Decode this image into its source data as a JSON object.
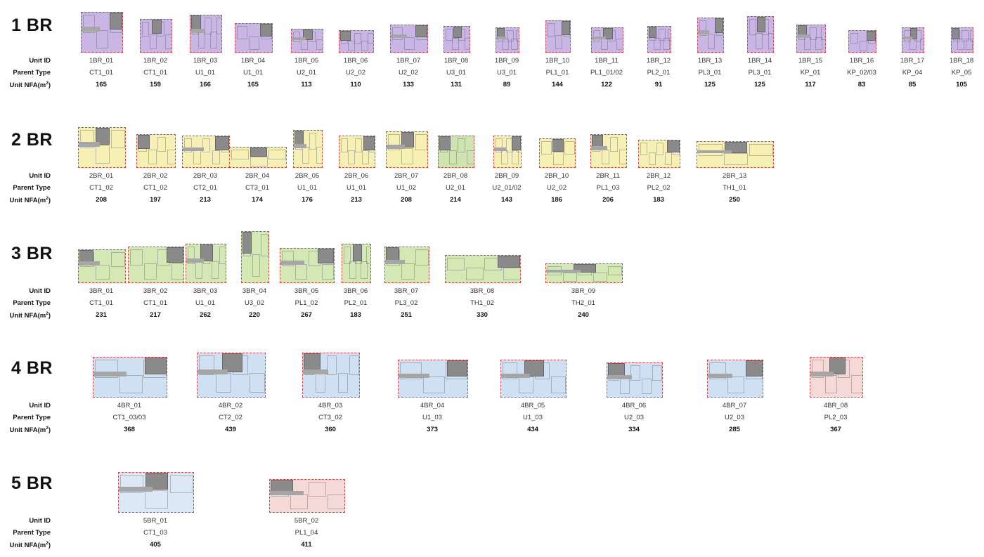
{
  "colors": {
    "1BR": "#c9b6e4",
    "2BR": "#f6f0b5",
    "2BR_alt": "#cfe3b0",
    "3BR": "#d3e8b4",
    "4BR": "#cfe0f3",
    "4BR_alt": "#f4d9d6",
    "5BR": "#dde8f5",
    "5BR_alt": "#f4d9d6",
    "core": "#8a8a8a",
    "boundary": "#dd4444"
  },
  "row_labels": {
    "unit_id": "Unit ID",
    "parent_type": "Parent Type",
    "nfa": "Unit NFA(m",
    "nfa_sup": "2",
    "nfa_close": ")"
  },
  "sections": [
    {
      "title": "1 BR",
      "units": [
        {
          "id": "1BR_01",
          "parent": "CT1_01",
          "nfa": "165"
        },
        {
          "id": "1BR_02",
          "parent": "CT1_01",
          "nfa": "159"
        },
        {
          "id": "1BR_03",
          "parent": "U1_01",
          "nfa": "166"
        },
        {
          "id": "1BR_04",
          "parent": "U1_01",
          "nfa": "165"
        },
        {
          "id": "1BR_05",
          "parent": "U2_01",
          "nfa": "113"
        },
        {
          "id": "1BR_06",
          "parent": "U2_02",
          "nfa": "110"
        },
        {
          "id": "1BR_07",
          "parent": "U2_02",
          "nfa": "133"
        },
        {
          "id": "1BR_08",
          "parent": "U3_01",
          "nfa": "131"
        },
        {
          "id": "1BR_09",
          "parent": "U3_01",
          "nfa": "89"
        },
        {
          "id": "1BR_10",
          "parent": "PL1_01",
          "nfa": "144"
        },
        {
          "id": "1BR_11",
          "parent": "PL1_01/02",
          "nfa": "122"
        },
        {
          "id": "1BR_12",
          "parent": "PL2_01",
          "nfa": "91"
        },
        {
          "id": "1BR_13",
          "parent": "PL3_01",
          "nfa": "125"
        },
        {
          "id": "1BR_14",
          "parent": "PL3_01",
          "nfa": "125"
        },
        {
          "id": "1BR_15",
          "parent": "KP_01",
          "nfa": "117"
        },
        {
          "id": "1BR_16",
          "parent": "KP_02/03",
          "nfa": "83"
        },
        {
          "id": "1BR_17",
          "parent": "KP_04",
          "nfa": "85"
        },
        {
          "id": "1BR_18",
          "parent": "KP_05",
          "nfa": "105"
        }
      ]
    },
    {
      "title": "2 BR",
      "units": [
        {
          "id": "2BR_01",
          "parent": "CT1_02",
          "nfa": "208"
        },
        {
          "id": "2BR_02",
          "parent": "CT1_02",
          "nfa": "197"
        },
        {
          "id": "2BR_03",
          "parent": "CT2_01",
          "nfa": "213"
        },
        {
          "id": "2BR_04",
          "parent": "CT3_01",
          "nfa": "174"
        },
        {
          "id": "2BR_05",
          "parent": "U1_01",
          "nfa": "176"
        },
        {
          "id": "2BR_06",
          "parent": "U1_01",
          "nfa": "213"
        },
        {
          "id": "2BR_07",
          "parent": "U1_02",
          "nfa": "208"
        },
        {
          "id": "2BR_08",
          "parent": "U2_01",
          "nfa": "214"
        },
        {
          "id": "2BR_09",
          "parent": "U2_01/02",
          "nfa": "143"
        },
        {
          "id": "2BR_10",
          "parent": "U2_02",
          "nfa": "186"
        },
        {
          "id": "2BR_11",
          "parent": "PL1_03",
          "nfa": "206"
        },
        {
          "id": "2BR_12",
          "parent": "PL2_02",
          "nfa": "183"
        },
        {
          "id": "2BR_13",
          "parent": "TH1_01",
          "nfa": "250"
        }
      ]
    },
    {
      "title": "3 BR",
      "units": [
        {
          "id": "3BR_01",
          "parent": "CT1_01",
          "nfa": "231"
        },
        {
          "id": "3BR_02",
          "parent": "CT1_01",
          "nfa": "217"
        },
        {
          "id": "3BR_03",
          "parent": "U1_01",
          "nfa": "262"
        },
        {
          "id": "3BR_04",
          "parent": "U3_02",
          "nfa": "220"
        },
        {
          "id": "3BR_05",
          "parent": "PL1_02",
          "nfa": "267"
        },
        {
          "id": "3BR_06",
          "parent": "PL2_01",
          "nfa": "183"
        },
        {
          "id": "3BR_07",
          "parent": "PL3_02",
          "nfa": "251"
        },
        {
          "id": "3BR_08",
          "parent": "TH1_02",
          "nfa": "330"
        },
        {
          "id": "3BR_09",
          "parent": "TH2_01",
          "nfa": "240"
        }
      ]
    },
    {
      "title": "4 BR",
      "units": [
        {
          "id": "4BR_01",
          "parent": "CT1_03/03",
          "nfa": "368"
        },
        {
          "id": "4BR_02",
          "parent": "CT2_02",
          "nfa": "439"
        },
        {
          "id": "4BR_03",
          "parent": "CT3_02",
          "nfa": "360"
        },
        {
          "id": "4BR_04",
          "parent": "U1_03",
          "nfa": "373"
        },
        {
          "id": "4BR_05",
          "parent": "U1_03",
          "nfa": "434"
        },
        {
          "id": "4BR_06",
          "parent": "U2_03",
          "nfa": "334"
        },
        {
          "id": "4BR_07",
          "parent": "U2_03",
          "nfa": "285"
        },
        {
          "id": "4BR_08",
          "parent": "PL2_03",
          "nfa": "367"
        }
      ]
    },
    {
      "title": "5 BR",
      "units": [
        {
          "id": "5BR_01",
          "parent": "CT1_03",
          "nfa": "405"
        },
        {
          "id": "5BR_02",
          "parent": "PL1_04",
          "nfa": "411"
        }
      ]
    }
  ]
}
